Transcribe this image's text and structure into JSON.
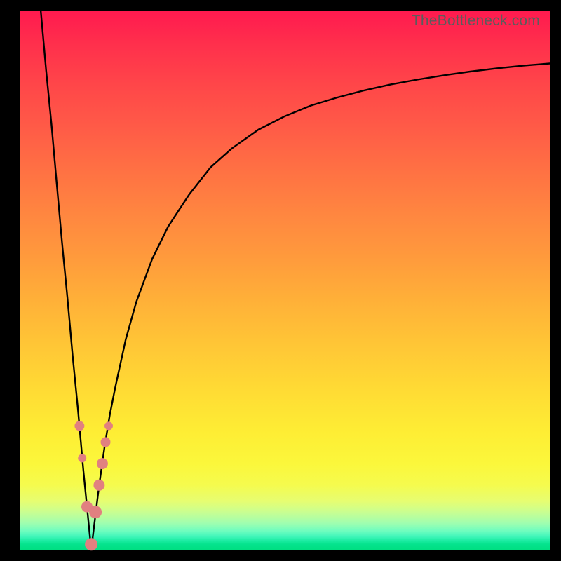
{
  "watermark": "TheBottleneck.com",
  "colors": {
    "curve": "#000000",
    "marker_fill": "#e18080",
    "marker_stroke": "#d06a6a",
    "frame_bg": "#000000"
  },
  "chart_data": {
    "type": "line",
    "title": "",
    "xlabel": "",
    "ylabel": "",
    "xlim": [
      0,
      100
    ],
    "ylim": [
      0,
      100
    ],
    "grid": false,
    "legend": false,
    "annotations": [
      {
        "text": "TheBottleneck.com",
        "position": "top-right"
      }
    ],
    "series": [
      {
        "name": "bottleneck-curve",
        "description": "V-shaped bottleneck deviation curve; minimum at the optimal hardware balance point.",
        "optimum_x": 13.5,
        "x": [
          4,
          5,
          6,
          7,
          8,
          9,
          10,
          11,
          12,
          13,
          13.5,
          14,
          15,
          16,
          17,
          18,
          20,
          22,
          25,
          28,
          32,
          36,
          40,
          45,
          50,
          55,
          60,
          65,
          70,
          75,
          80,
          85,
          90,
          95,
          100
        ],
        "y": [
          100,
          89,
          79,
          68,
          57,
          47,
          36,
          26,
          15,
          5,
          0,
          4,
          12,
          19,
          25,
          30,
          39,
          46,
          54,
          60,
          66,
          71,
          74.5,
          78,
          80.5,
          82.5,
          84,
          85.3,
          86.4,
          87.3,
          88.1,
          88.8,
          89.4,
          89.9,
          90.3
        ]
      }
    ],
    "markers": {
      "name": "highlight-dots",
      "color": "#e18080",
      "points": [
        {
          "x": 11.3,
          "y": 23,
          "r": 7
        },
        {
          "x": 11.8,
          "y": 17,
          "r": 6
        },
        {
          "x": 12.7,
          "y": 8,
          "r": 8
        },
        {
          "x": 13.5,
          "y": 1,
          "r": 9
        },
        {
          "x": 14.3,
          "y": 7,
          "r": 9
        },
        {
          "x": 15.0,
          "y": 12,
          "r": 8
        },
        {
          "x": 15.6,
          "y": 16,
          "r": 8
        },
        {
          "x": 16.2,
          "y": 20,
          "r": 7
        },
        {
          "x": 16.8,
          "y": 23,
          "r": 6
        }
      ]
    }
  }
}
